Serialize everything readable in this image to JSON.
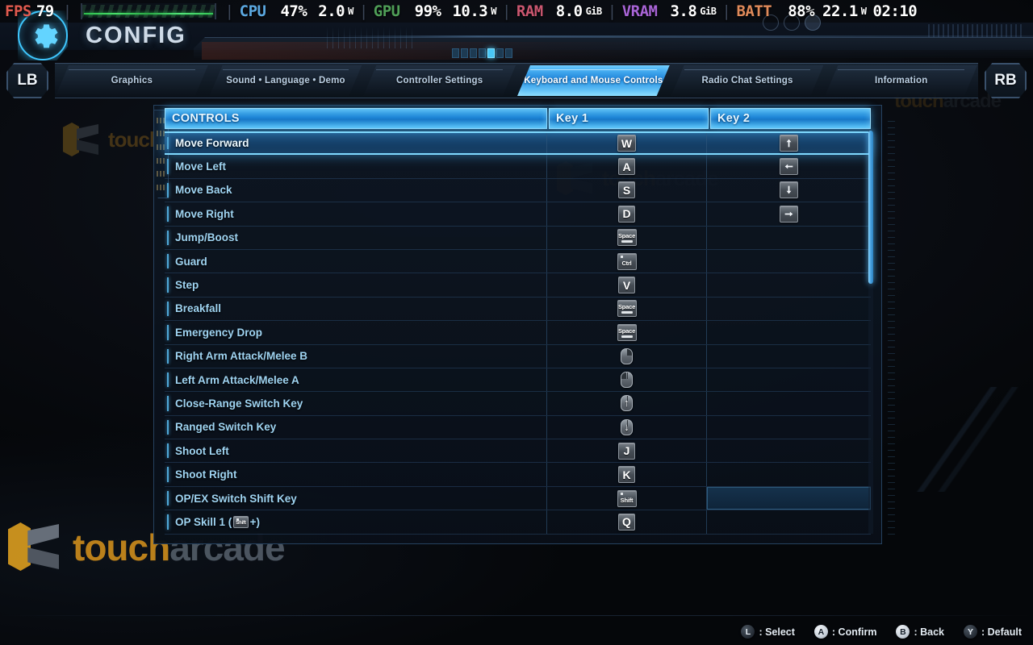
{
  "perf_overlay": {
    "fps": {
      "label": "FPS",
      "value": "79"
    },
    "cpu": {
      "label": "CPU",
      "usage": "47%",
      "power": "2.0",
      "power_unit": "W"
    },
    "gpu": {
      "label": "GPU",
      "usage": "99%",
      "power": "10.3",
      "power_unit": "W"
    },
    "ram": {
      "label": "RAM",
      "value": "8.0",
      "unit": "GiB"
    },
    "vram": {
      "label": "VRAM",
      "value": "3.8",
      "unit": "GiB"
    },
    "batt": {
      "label": "BATT",
      "percent": "88%",
      "power": "22.1",
      "power_unit": "W",
      "time": "02:10"
    },
    "colors": {
      "fps": "#e05a4f",
      "cpu": "#5ba8e0",
      "gpu": "#4f9e57",
      "ram": "#c9566f",
      "vram": "#a864d6",
      "batt": "#e08a5a"
    }
  },
  "header": {
    "title": "CONFIG",
    "gear_icon": "gear-icon"
  },
  "tabbar": {
    "left_shoulder": "LB",
    "right_shoulder": "RB",
    "tabs": [
      {
        "label": "Graphics",
        "active": false
      },
      {
        "label": "Sound • Language • Demo",
        "active": false
      },
      {
        "label": "Controller Settings",
        "active": false
      },
      {
        "label": "Keyboard and Mouse Controls",
        "active": true
      },
      {
        "label": "Radio Chat Settings",
        "active": false
      },
      {
        "label": "Information",
        "active": false
      }
    ]
  },
  "table": {
    "headers": {
      "controls": "CONTROLS",
      "key1": "Key 1",
      "key2": "Key 2"
    },
    "rows": [
      {
        "name": "Move Forward",
        "key1": {
          "type": "key",
          "label": "W"
        },
        "key2": {
          "type": "arrow",
          "dir": "up"
        },
        "selected": true,
        "key2_focus": false
      },
      {
        "name": "Move Left",
        "key1": {
          "type": "key",
          "label": "A"
        },
        "key2": {
          "type": "arrow",
          "dir": "left"
        },
        "selected": false,
        "key2_focus": false
      },
      {
        "name": "Move Back",
        "key1": {
          "type": "key",
          "label": "S"
        },
        "key2": {
          "type": "arrow",
          "dir": "down"
        },
        "selected": false,
        "key2_focus": false
      },
      {
        "name": "Move Right",
        "key1": {
          "type": "key",
          "label": "D"
        },
        "key2": {
          "type": "arrow",
          "dir": "right"
        },
        "selected": false,
        "key2_focus": false
      },
      {
        "name": "Jump/Boost",
        "key1": {
          "type": "wide",
          "label": "Space"
        },
        "key2": {
          "type": "none"
        },
        "selected": false,
        "key2_focus": false
      },
      {
        "name": "Guard",
        "key1": {
          "type": "ctrl",
          "label": "Ctrl"
        },
        "key2": {
          "type": "none"
        },
        "selected": false,
        "key2_focus": false
      },
      {
        "name": "Step",
        "key1": {
          "type": "key",
          "label": "V"
        },
        "key2": {
          "type": "none"
        },
        "selected": false,
        "key2_focus": false
      },
      {
        "name": "Breakfall",
        "key1": {
          "type": "wide",
          "label": "Space"
        },
        "key2": {
          "type": "none"
        },
        "selected": false,
        "key2_focus": false
      },
      {
        "name": "Emergency Drop",
        "key1": {
          "type": "wide",
          "label": "Space"
        },
        "key2": {
          "type": "none"
        },
        "selected": false,
        "key2_focus": false
      },
      {
        "name": "Right Arm Attack/Melee B",
        "key1": {
          "type": "mouse",
          "button": "right"
        },
        "key2": {
          "type": "none"
        },
        "selected": false,
        "key2_focus": false
      },
      {
        "name": "Left Arm Attack/Melee A",
        "key1": {
          "type": "mouse",
          "button": "left"
        },
        "key2": {
          "type": "none"
        },
        "selected": false,
        "key2_focus": false
      },
      {
        "name": "Close-Range Switch Key",
        "key1": {
          "type": "mouse",
          "button": "wheel-up"
        },
        "key2": {
          "type": "none"
        },
        "selected": false,
        "key2_focus": false
      },
      {
        "name": "Ranged Switch Key",
        "key1": {
          "type": "mouse",
          "button": "wheel-down"
        },
        "key2": {
          "type": "none"
        },
        "selected": false,
        "key2_focus": false
      },
      {
        "name": "Shoot Left",
        "key1": {
          "type": "key",
          "label": "J"
        },
        "key2": {
          "type": "none"
        },
        "selected": false,
        "key2_focus": false
      },
      {
        "name": "Shoot Right",
        "key1": {
          "type": "key",
          "label": "K"
        },
        "key2": {
          "type": "none"
        },
        "selected": false,
        "key2_focus": false
      },
      {
        "name": "OP/EX Switch Shift Key",
        "key1": {
          "type": "shift",
          "label": "Shift"
        },
        "key2": {
          "type": "none"
        },
        "selected": false,
        "key2_focus": true
      },
      {
        "name": "OP Skill 1 (",
        "name_suffix": "+)",
        "inline_key": "Shift",
        "key1": {
          "type": "key",
          "label": "Q"
        },
        "key2": {
          "type": "none"
        },
        "selected": false,
        "key2_focus": false
      }
    ],
    "scroll": {
      "thumb_percent": 38
    }
  },
  "watermark": {
    "brand_a": "touch",
    "brand_b": "arcade"
  },
  "footer": {
    "hints": [
      {
        "button": "L",
        "dark": true,
        "label": ": Select"
      },
      {
        "button": "A",
        "dark": false,
        "label": ": Confirm"
      },
      {
        "button": "B",
        "dark": false,
        "label": ": Back"
      },
      {
        "button": "Y",
        "dark": true,
        "label": ": Default"
      }
    ]
  }
}
